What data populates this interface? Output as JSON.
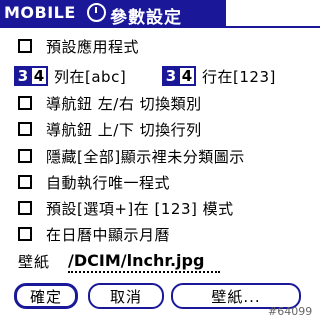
{
  "title_bar": {
    "brand": "MOBILE",
    "title": "參數設定"
  },
  "options": [
    {
      "label": "預設應用程式",
      "checked": false
    },
    {
      "label": "導航鈕 左/右 切換類別",
      "checked": false
    },
    {
      "label": "導航鈕 上/下 切換行列",
      "checked": false
    },
    {
      "label": "隱藏[全部]顯示裡未分類圖示",
      "checked": false
    },
    {
      "label": "自動執行唯一程式",
      "checked": false
    },
    {
      "label": "預設[選項+]在 [123] 模式",
      "checked": false
    },
    {
      "label": "在日曆中顯示月曆",
      "checked": false
    }
  ],
  "column_setting": {
    "opt_selected": "3",
    "opt_other": "4",
    "label": "列在[abc]"
  },
  "row_setting": {
    "opt_selected": "3",
    "opt_other": "4",
    "label": "行在[123]"
  },
  "wallpaper": {
    "label": "壁紙",
    "value": "/DCIM/lnchr.jpg"
  },
  "buttons": {
    "ok": "確定",
    "cancel": "取消",
    "wallpaper": "壁紙..."
  },
  "watermark": "#64099",
  "colors": {
    "accent": "#1a1899",
    "background": "#ffffff",
    "text": "#000000"
  }
}
